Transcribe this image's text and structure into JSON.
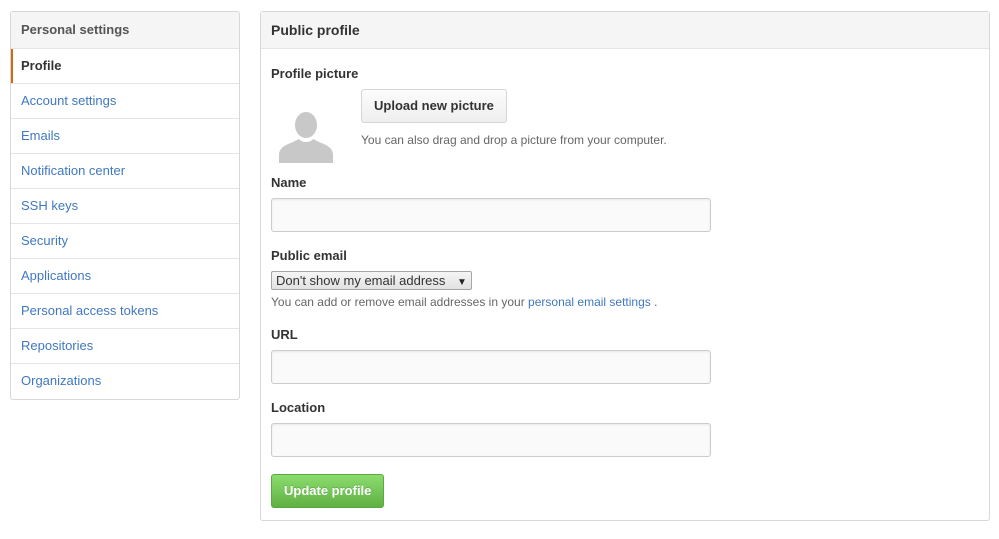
{
  "sidebar": {
    "title": "Personal settings",
    "items": [
      {
        "label": "Profile"
      },
      {
        "label": "Account settings"
      },
      {
        "label": "Emails"
      },
      {
        "label": "Notification center"
      },
      {
        "label": "SSH keys"
      },
      {
        "label": "Security"
      },
      {
        "label": "Applications"
      },
      {
        "label": "Personal access tokens"
      },
      {
        "label": "Repositories"
      },
      {
        "label": "Organizations"
      }
    ],
    "selected": "Profile"
  },
  "profile": {
    "title": "Public profile",
    "picture": {
      "label": "Profile picture",
      "upload_label": "Upload new picture",
      "note": "You can also drag and drop a picture from your computer."
    },
    "name": {
      "label": "Name",
      "value": ""
    },
    "public_email": {
      "label": "Public email",
      "selected": "Don't show my email address",
      "note_prefix": "You can add or remove email addresses in your",
      "note_link": "personal email settings",
      "note_suffix": "."
    },
    "url": {
      "label": "URL",
      "value": ""
    },
    "location": {
      "label": "Location",
      "value": ""
    },
    "update_label": "Update profile"
  },
  "colors": {
    "link": "#4078c0",
    "selected_marker": "#d26911",
    "update_button": "#60b044"
  },
  "icons": {
    "avatar": "default-avatar-silhouette",
    "select_caret": "triangle-down"
  }
}
